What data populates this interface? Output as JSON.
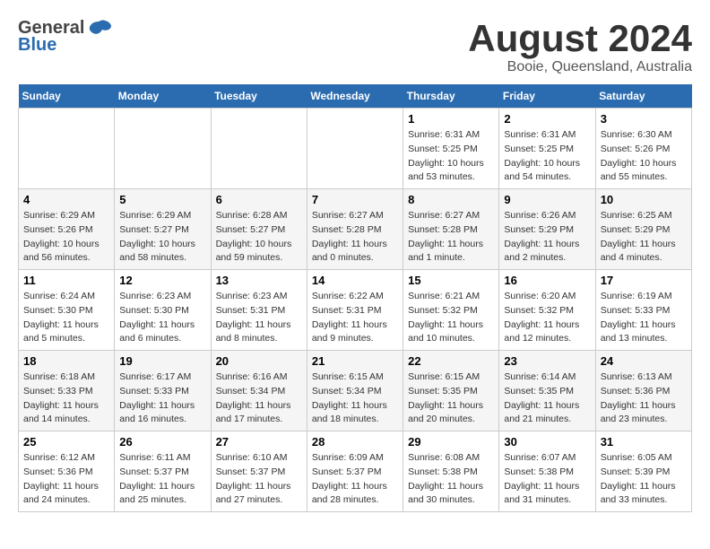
{
  "header": {
    "logo_general": "General",
    "logo_blue": "Blue",
    "title": "August 2024",
    "location": "Booie, Queensland, Australia"
  },
  "days_of_week": [
    "Sunday",
    "Monday",
    "Tuesday",
    "Wednesday",
    "Thursday",
    "Friday",
    "Saturday"
  ],
  "weeks": [
    [
      {
        "num": "",
        "info": ""
      },
      {
        "num": "",
        "info": ""
      },
      {
        "num": "",
        "info": ""
      },
      {
        "num": "",
        "info": ""
      },
      {
        "num": "1",
        "info": "Sunrise: 6:31 AM\nSunset: 5:25 PM\nDaylight: 10 hours\nand 53 minutes."
      },
      {
        "num": "2",
        "info": "Sunrise: 6:31 AM\nSunset: 5:25 PM\nDaylight: 10 hours\nand 54 minutes."
      },
      {
        "num": "3",
        "info": "Sunrise: 6:30 AM\nSunset: 5:26 PM\nDaylight: 10 hours\nand 55 minutes."
      }
    ],
    [
      {
        "num": "4",
        "info": "Sunrise: 6:29 AM\nSunset: 5:26 PM\nDaylight: 10 hours\nand 56 minutes."
      },
      {
        "num": "5",
        "info": "Sunrise: 6:29 AM\nSunset: 5:27 PM\nDaylight: 10 hours\nand 58 minutes."
      },
      {
        "num": "6",
        "info": "Sunrise: 6:28 AM\nSunset: 5:27 PM\nDaylight: 10 hours\nand 59 minutes."
      },
      {
        "num": "7",
        "info": "Sunrise: 6:27 AM\nSunset: 5:28 PM\nDaylight: 11 hours\nand 0 minutes."
      },
      {
        "num": "8",
        "info": "Sunrise: 6:27 AM\nSunset: 5:28 PM\nDaylight: 11 hours\nand 1 minute."
      },
      {
        "num": "9",
        "info": "Sunrise: 6:26 AM\nSunset: 5:29 PM\nDaylight: 11 hours\nand 2 minutes."
      },
      {
        "num": "10",
        "info": "Sunrise: 6:25 AM\nSunset: 5:29 PM\nDaylight: 11 hours\nand 4 minutes."
      }
    ],
    [
      {
        "num": "11",
        "info": "Sunrise: 6:24 AM\nSunset: 5:30 PM\nDaylight: 11 hours\nand 5 minutes."
      },
      {
        "num": "12",
        "info": "Sunrise: 6:23 AM\nSunset: 5:30 PM\nDaylight: 11 hours\nand 6 minutes."
      },
      {
        "num": "13",
        "info": "Sunrise: 6:23 AM\nSunset: 5:31 PM\nDaylight: 11 hours\nand 8 minutes."
      },
      {
        "num": "14",
        "info": "Sunrise: 6:22 AM\nSunset: 5:31 PM\nDaylight: 11 hours\nand 9 minutes."
      },
      {
        "num": "15",
        "info": "Sunrise: 6:21 AM\nSunset: 5:32 PM\nDaylight: 11 hours\nand 10 minutes."
      },
      {
        "num": "16",
        "info": "Sunrise: 6:20 AM\nSunset: 5:32 PM\nDaylight: 11 hours\nand 12 minutes."
      },
      {
        "num": "17",
        "info": "Sunrise: 6:19 AM\nSunset: 5:33 PM\nDaylight: 11 hours\nand 13 minutes."
      }
    ],
    [
      {
        "num": "18",
        "info": "Sunrise: 6:18 AM\nSunset: 5:33 PM\nDaylight: 11 hours\nand 14 minutes."
      },
      {
        "num": "19",
        "info": "Sunrise: 6:17 AM\nSunset: 5:33 PM\nDaylight: 11 hours\nand 16 minutes."
      },
      {
        "num": "20",
        "info": "Sunrise: 6:16 AM\nSunset: 5:34 PM\nDaylight: 11 hours\nand 17 minutes."
      },
      {
        "num": "21",
        "info": "Sunrise: 6:15 AM\nSunset: 5:34 PM\nDaylight: 11 hours\nand 18 minutes."
      },
      {
        "num": "22",
        "info": "Sunrise: 6:15 AM\nSunset: 5:35 PM\nDaylight: 11 hours\nand 20 minutes."
      },
      {
        "num": "23",
        "info": "Sunrise: 6:14 AM\nSunset: 5:35 PM\nDaylight: 11 hours\nand 21 minutes."
      },
      {
        "num": "24",
        "info": "Sunrise: 6:13 AM\nSunset: 5:36 PM\nDaylight: 11 hours\nand 23 minutes."
      }
    ],
    [
      {
        "num": "25",
        "info": "Sunrise: 6:12 AM\nSunset: 5:36 PM\nDaylight: 11 hours\nand 24 minutes."
      },
      {
        "num": "26",
        "info": "Sunrise: 6:11 AM\nSunset: 5:37 PM\nDaylight: 11 hours\nand 25 minutes."
      },
      {
        "num": "27",
        "info": "Sunrise: 6:10 AM\nSunset: 5:37 PM\nDaylight: 11 hours\nand 27 minutes."
      },
      {
        "num": "28",
        "info": "Sunrise: 6:09 AM\nSunset: 5:37 PM\nDaylight: 11 hours\nand 28 minutes."
      },
      {
        "num": "29",
        "info": "Sunrise: 6:08 AM\nSunset: 5:38 PM\nDaylight: 11 hours\nand 30 minutes."
      },
      {
        "num": "30",
        "info": "Sunrise: 6:07 AM\nSunset: 5:38 PM\nDaylight: 11 hours\nand 31 minutes."
      },
      {
        "num": "31",
        "info": "Sunrise: 6:05 AM\nSunset: 5:39 PM\nDaylight: 11 hours\nand 33 minutes."
      }
    ]
  ]
}
